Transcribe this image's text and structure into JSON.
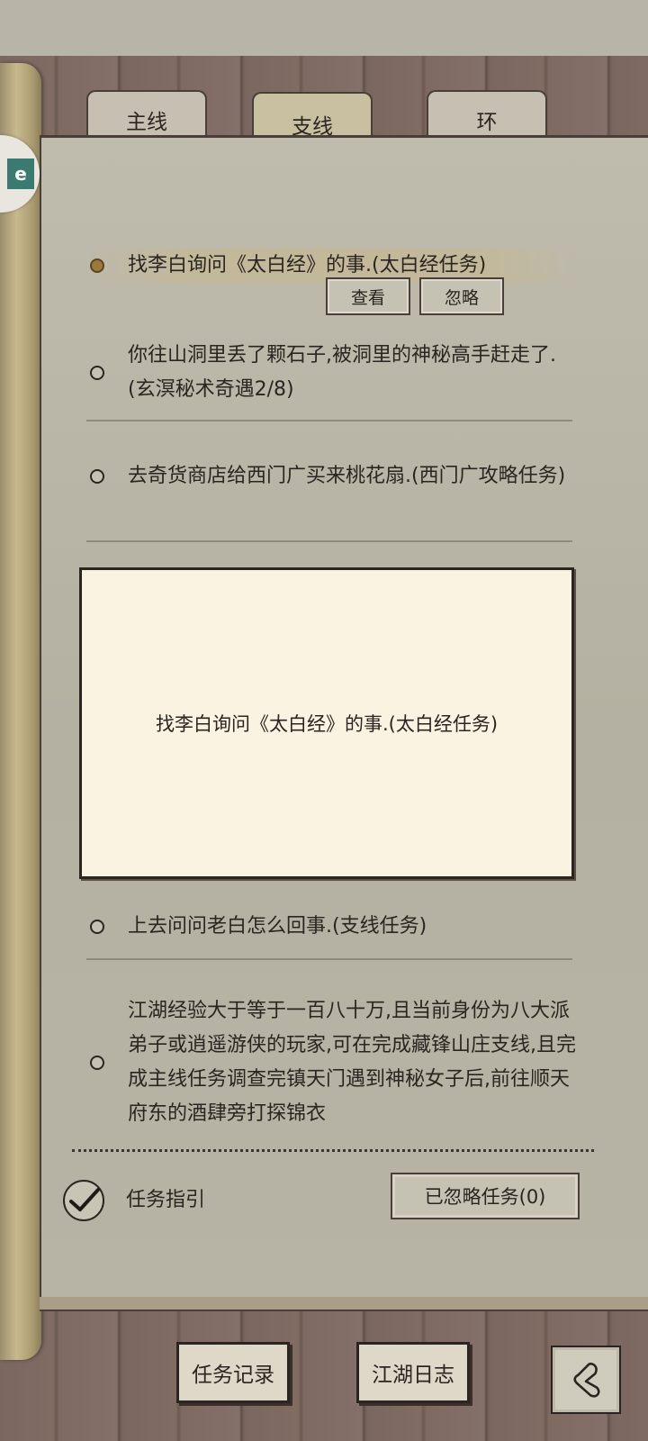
{
  "tabs": [
    {
      "label": "主线"
    },
    {
      "label": "支线"
    },
    {
      "label": "环"
    }
  ],
  "side_badge": {
    "glyph": "e"
  },
  "quests": [
    {
      "text": "找李白询问《太白经》的事.(太白经任务)"
    },
    {
      "text": "你往山洞里丢了颗石子,被洞里的神秘高手赶走了.(玄溟秘术奇遇2/8)"
    },
    {
      "text": "去奇货商店给西门广买来桃花扇.(西门广攻略任务)"
    },
    {
      "text": "上去问问老白怎么回事.(支线任务)"
    },
    {
      "text": "江湖经验大于等于一百八十万,且当前身份为八大派弟子或逍遥游侠的玩家,可在完成藏锋山庄支线,且完成主线任务调查完镇天门遇到神秘女子后,前往顺天府东的酒肆旁打探锦衣"
    }
  ],
  "quest_actions": {
    "view": "查看",
    "ignore": "忽略"
  },
  "popup": {
    "text": "找李白询问《太白经》的事.(太白经任务)"
  },
  "footer": {
    "guide_label": "任务指引",
    "ignored_tasks": "已忽略任务(0)"
  },
  "bottom_nav": {
    "records": "任务记录",
    "journal": "江湖日志"
  },
  "icons": {
    "check": "checkmark-icon",
    "back": "back-icon",
    "badge": "app-badge-icon"
  }
}
